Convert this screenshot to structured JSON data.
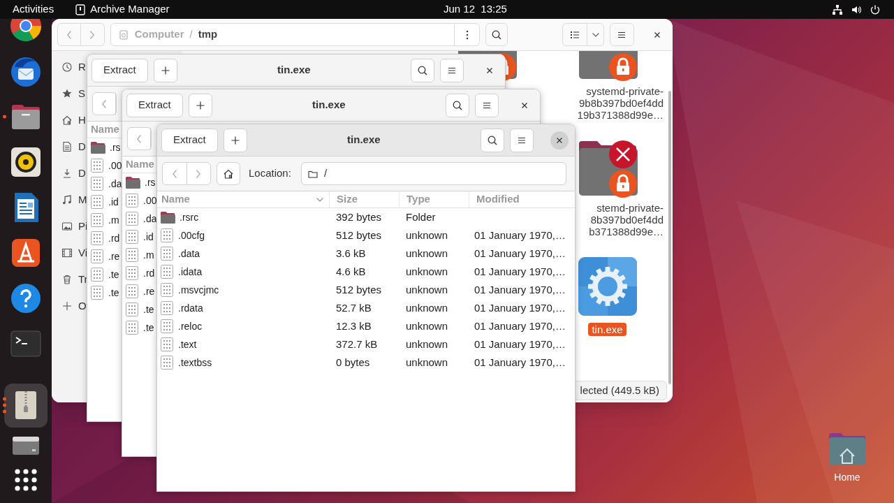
{
  "top_bar": {
    "activities": "Activities",
    "app_name": "Archive Manager",
    "clock": "Jun 12  13:25"
  },
  "dock": [
    {
      "kind": "browser",
      "selected": false,
      "running": false
    },
    {
      "kind": "mail",
      "selected": false,
      "running": false
    },
    {
      "kind": "files",
      "selected": false,
      "running": true,
      "multiple_windows": false
    },
    {
      "kind": "music",
      "selected": false,
      "running": false
    },
    {
      "kind": "writer",
      "selected": false,
      "running": false
    },
    {
      "kind": "store",
      "selected": false,
      "running": false
    },
    {
      "kind": "help",
      "selected": false,
      "running": false
    },
    {
      "kind": "terminal",
      "selected": false,
      "running": false
    },
    {
      "kind": "archive",
      "selected": true,
      "running": true,
      "multiple_windows": true
    },
    {
      "kind": "drive",
      "selected": false,
      "running": false
    },
    {
      "kind": "apps",
      "selected": false,
      "running": false
    }
  ],
  "file_manager": {
    "path": {
      "separator": "/",
      "segments": [
        {
          "label": "Computer",
          "current": false
        },
        {
          "label": "tmp",
          "current": true
        }
      ]
    },
    "sidebar": [
      {
        "kind": "recent",
        "label": "R"
      },
      {
        "kind": "starred",
        "label": "S"
      },
      {
        "kind": "home",
        "label": "H"
      },
      {
        "kind": "documents",
        "label": "D"
      },
      {
        "kind": "downloads",
        "label": "D"
      },
      {
        "kind": "music",
        "label": "M"
      },
      {
        "kind": "pictures",
        "label": "Pi"
      },
      {
        "kind": "videos",
        "label": "Vi"
      },
      {
        "kind": "trash",
        "label": "Tr"
      },
      {
        "kind": "other",
        "label": "O"
      }
    ],
    "items": [
      {
        "kind": "folder",
        "locked": true,
        "error": false,
        "selected": false
      },
      {
        "kind": "folder",
        "locked": true,
        "error": false,
        "selected": false,
        "label_lines": [
          "systemd-private-",
          "9b8b397bd0ef4dd",
          "19b371388d99e…"
        ]
      },
      {
        "kind": "folder",
        "locked": true,
        "error": true,
        "selected": false,
        "label_lines": [
          "stemd-private-",
          "8b397bd0ef4dd",
          "b371388d99e…"
        ]
      },
      {
        "kind": "executable",
        "selected": true,
        "label_lines": [
          "tin.exe"
        ]
      }
    ],
    "status": "lected (449.5 kB)"
  },
  "archive_windows": [
    {
      "title": "tin.exe",
      "focused": false,
      "extract": "Extract",
      "columns": [
        {
          "label": "Name"
        }
      ],
      "rows": [
        {
          "kind": "folder",
          "cells": [
            ".rs"
          ]
        },
        {
          "kind": "file",
          "cells": [
            ".00"
          ]
        },
        {
          "kind": "file",
          "cells": [
            ".da"
          ]
        },
        {
          "kind": "file",
          "cells": [
            ".id"
          ]
        },
        {
          "kind": "file",
          "cells": [
            ".m"
          ]
        },
        {
          "kind": "file",
          "cells": [
            ".rd"
          ]
        },
        {
          "kind": "file",
          "cells": [
            ".re"
          ]
        },
        {
          "kind": "file",
          "cells": [
            ".te"
          ]
        },
        {
          "kind": "file",
          "cells": [
            ".te"
          ]
        }
      ]
    },
    {
      "title": "tin.exe",
      "focused": false,
      "extract": "Extract",
      "columns": [
        {
          "label": "Name"
        }
      ],
      "rows": [
        {
          "kind": "folder",
          "cells": [
            ".rs"
          ]
        },
        {
          "kind": "file",
          "cells": [
            ".00"
          ]
        },
        {
          "kind": "file",
          "cells": [
            ".da"
          ]
        },
        {
          "kind": "file",
          "cells": [
            ".id"
          ]
        },
        {
          "kind": "file",
          "cells": [
            ".m"
          ]
        },
        {
          "kind": "file",
          "cells": [
            ".rd"
          ]
        },
        {
          "kind": "file",
          "cells": [
            ".re"
          ]
        },
        {
          "kind": "file",
          "cells": [
            ".te"
          ]
        },
        {
          "kind": "file",
          "cells": [
            ".te"
          ]
        }
      ]
    },
    {
      "title": "tin.exe",
      "focused": true,
      "extract": "Extract",
      "location_label": "Location:",
      "location": "/",
      "columns": [
        {
          "label": "Name",
          "sorted": true
        },
        {
          "label": "Size",
          "sorted": false
        },
        {
          "label": "Type",
          "sorted": false
        },
        {
          "label": "Modified",
          "sorted": false
        }
      ],
      "rows": [
        {
          "kind": "folder",
          "cells": [
            ".rsrc",
            "392 bytes",
            "Folder"
          ]
        },
        {
          "kind": "file",
          "cells": [
            ".00cfg",
            "512 bytes",
            "unknown",
            "01 January 1970,…"
          ]
        },
        {
          "kind": "file",
          "cells": [
            ".data",
            "3.6 kB",
            "unknown",
            "01 January 1970,…"
          ]
        },
        {
          "kind": "file",
          "cells": [
            ".idata",
            "4.6 kB",
            "unknown",
            "01 January 1970,…"
          ]
        },
        {
          "kind": "file",
          "cells": [
            ".msvcjmc",
            "512 bytes",
            "unknown",
            "01 January 1970,…"
          ]
        },
        {
          "kind": "file",
          "cells": [
            ".rdata",
            "52.7 kB",
            "unknown",
            "01 January 1970,…"
          ]
        },
        {
          "kind": "file",
          "cells": [
            ".reloc",
            "12.3 kB",
            "unknown",
            "01 January 1970,…"
          ]
        },
        {
          "kind": "file",
          "cells": [
            ".text",
            "372.7 kB",
            "unknown",
            "01 January 1970,…"
          ]
        },
        {
          "kind": "file",
          "cells": [
            ".textbss",
            "0 bytes",
            "unknown",
            "01 January 1970,…"
          ]
        }
      ]
    }
  ],
  "desktop_icons": [
    {
      "label": "Home"
    }
  ]
}
